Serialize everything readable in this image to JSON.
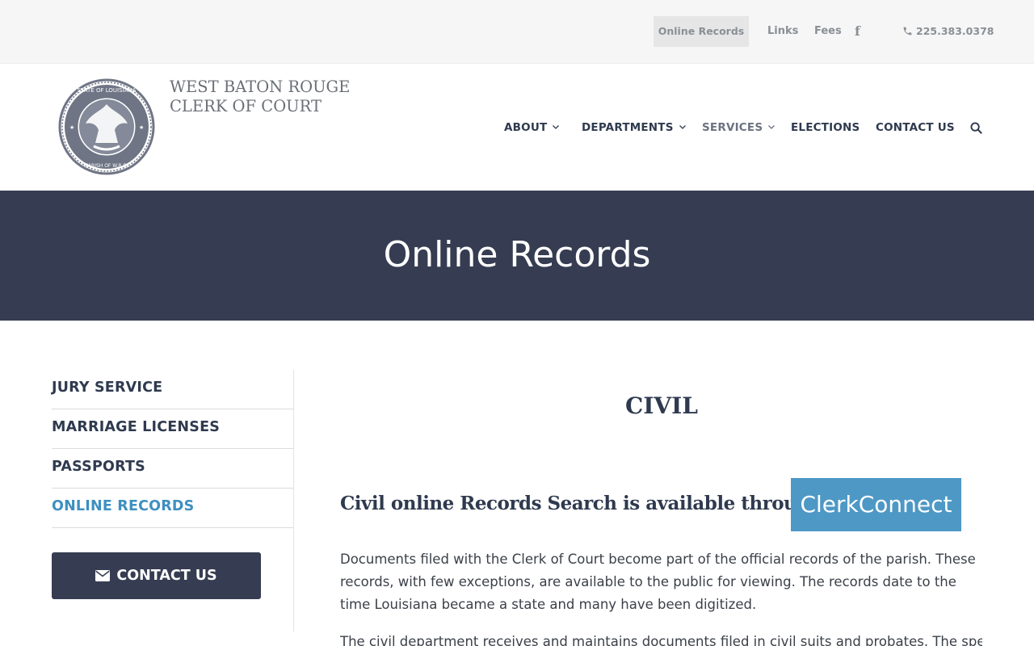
{
  "utility": {
    "online_records": "Online Records",
    "links": "Links",
    "fees": "Fees",
    "facebook_glyph": "f",
    "phone": "225.383.0378"
  },
  "brand": {
    "line1": "WEST BATON ROUGE",
    "line2": "CLERK OF COURT",
    "seal_text": "STATE OF LOUISIANA · PARISH OF WEST BATON ROUGE"
  },
  "nav": {
    "about": "ABOUT",
    "departments": "DEPARTMENTS",
    "services": "SERVICES",
    "elections": "ELECTIONS",
    "contact": "CONTACT US"
  },
  "hero": {
    "title": "Online Records"
  },
  "sidebar": {
    "items": [
      {
        "label": "JURY SERVICE"
      },
      {
        "label": "MARRIAGE LICENSES"
      },
      {
        "label": "PASSPORTS"
      },
      {
        "label": "ONLINE RECORDS"
      }
    ],
    "contact_button": "CONTACT US"
  },
  "main": {
    "section_title": "CIVIL",
    "subheading": "Civil online Records Search is available through",
    "clerk_button": "ClerkConnect",
    "paragraph1": "Documents filed with the Clerk of Court become part of the official records of the parish. These records, with few exceptions, are available to the public for viewing. The records date to the time Louisiana became a state and many have been digitized.",
    "paragraph2": "The civil department receives and maintains documents filed in civil suits and probates. The specific"
  },
  "colors": {
    "navy": "#363d52",
    "accent_blue": "#4e98c6",
    "active_link": "#3e8fc0"
  }
}
